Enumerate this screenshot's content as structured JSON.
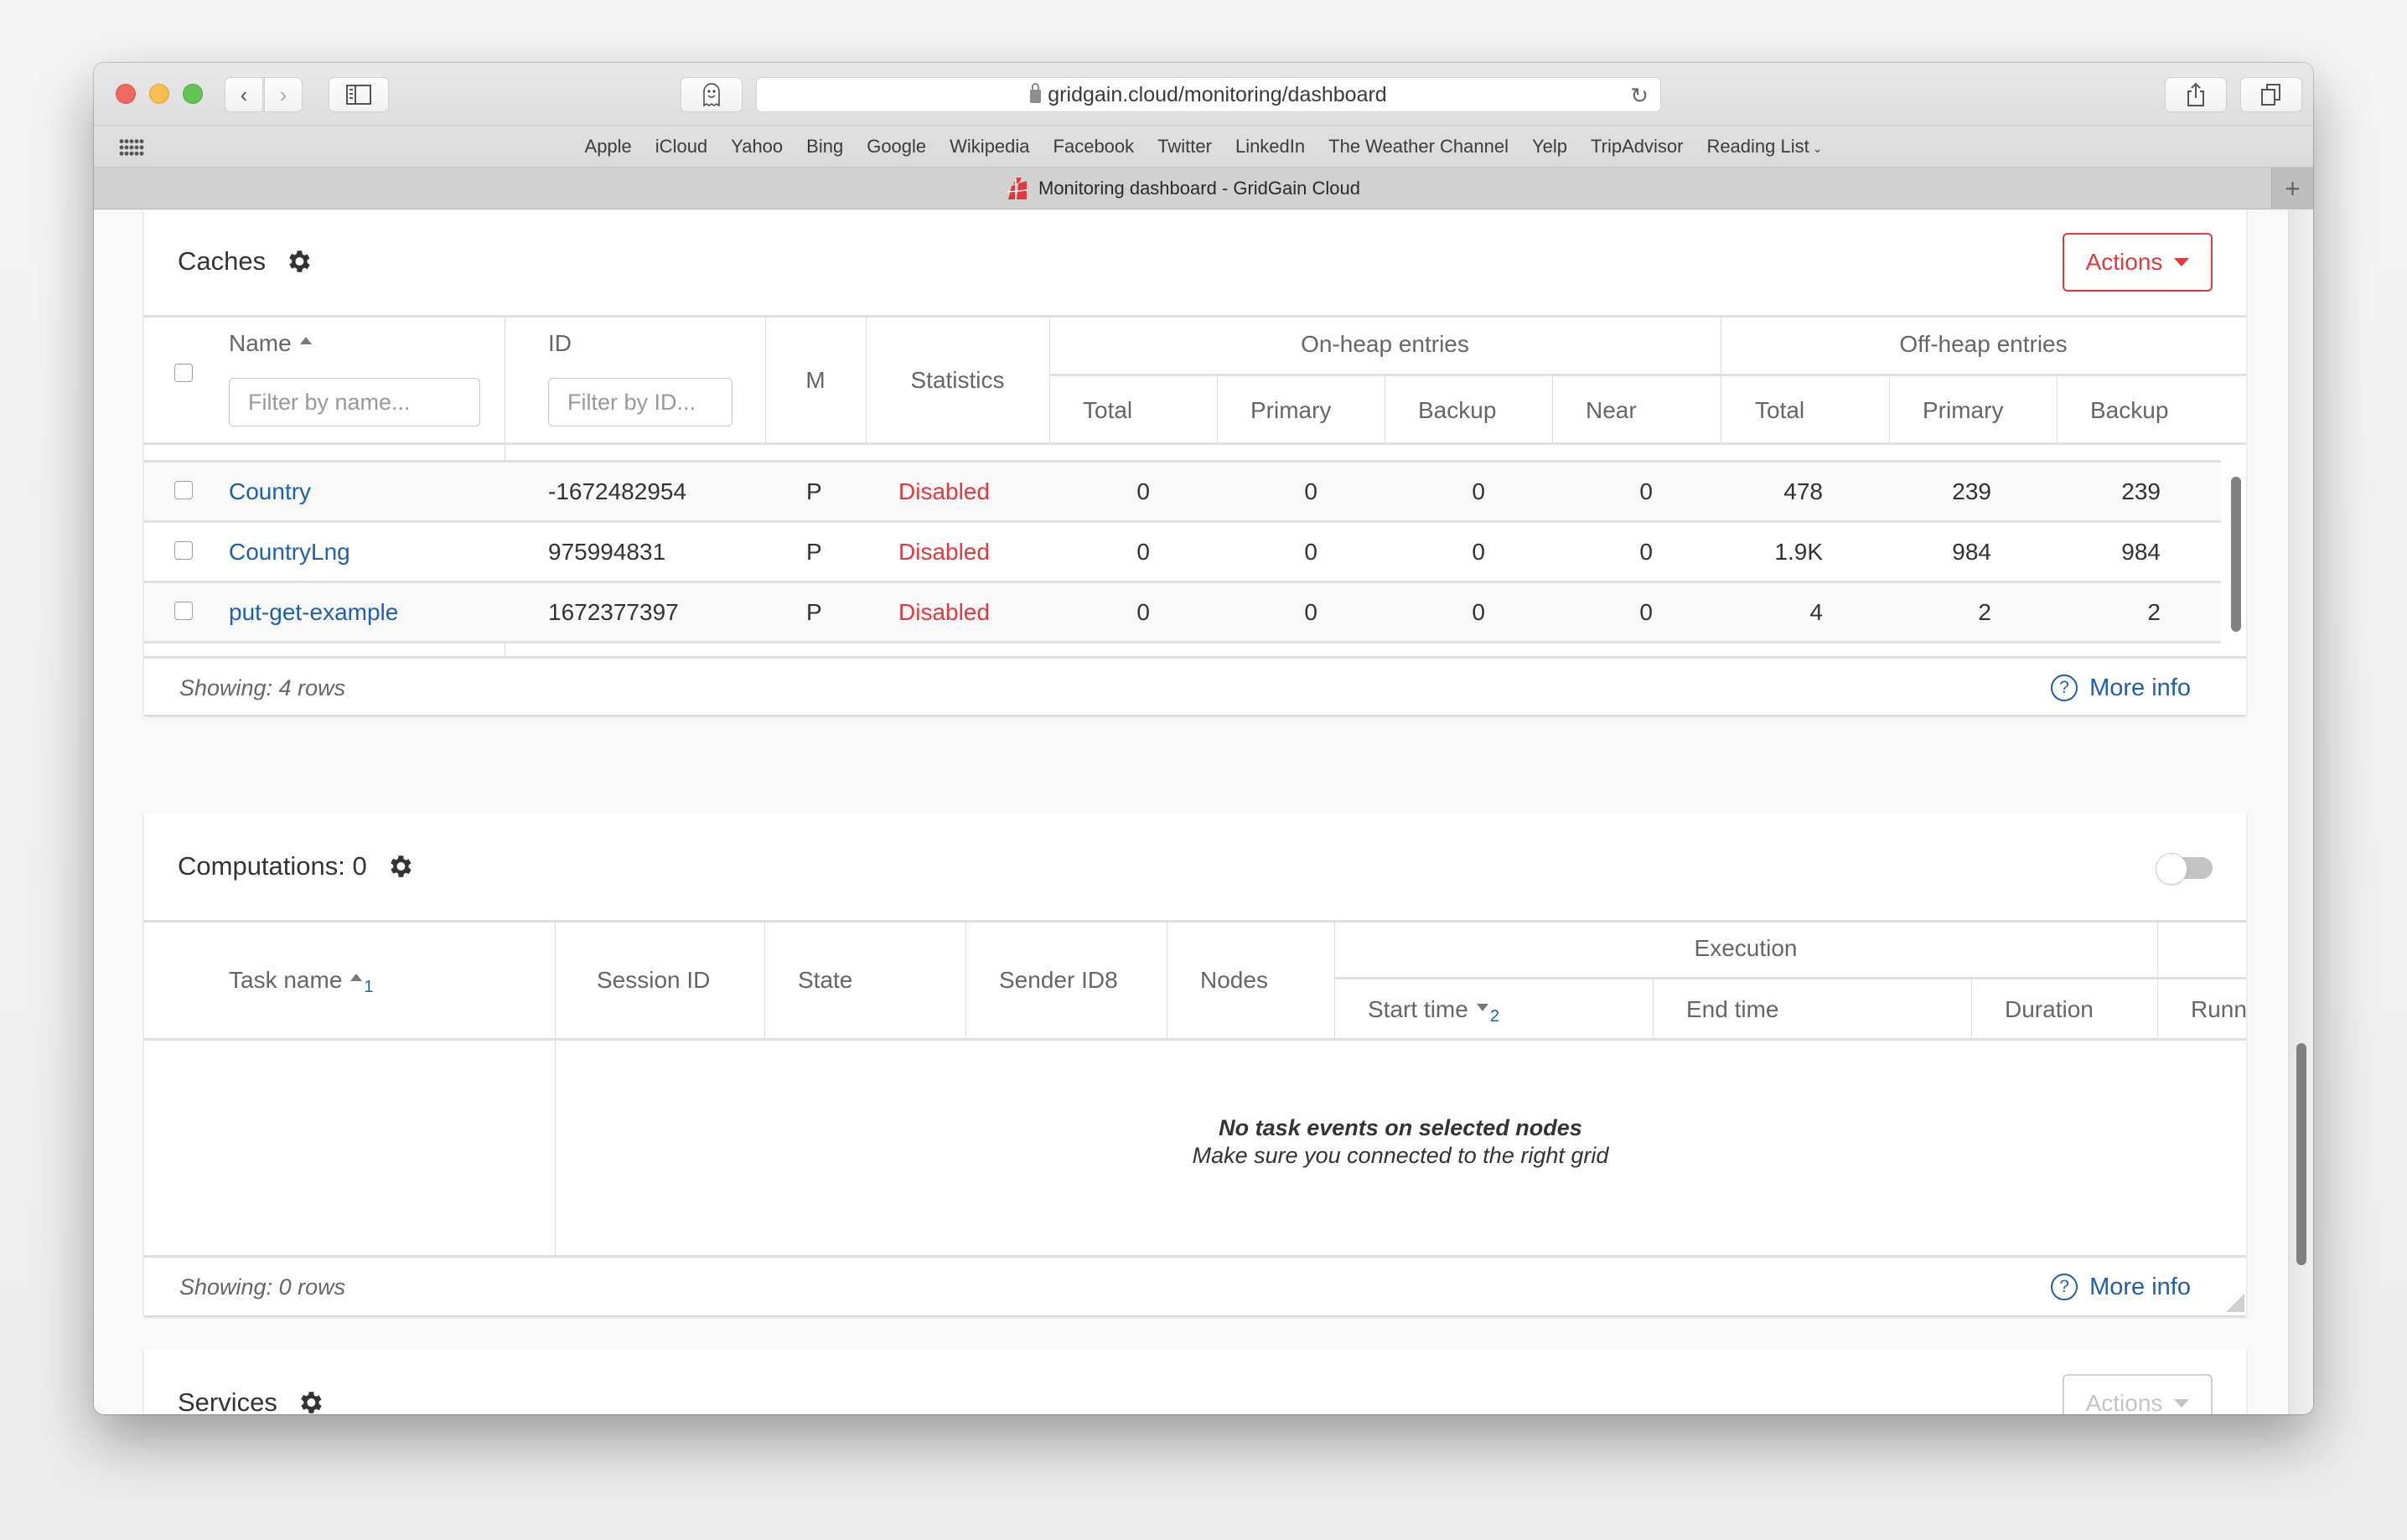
{
  "browser": {
    "url": "gridgain.cloud/monitoring/dashboard",
    "tab_title": "Monitoring dashboard - GridGain Cloud",
    "new_tab_label": "+",
    "bookmarks": [
      "Apple",
      "iCloud",
      "Yahoo",
      "Bing",
      "Google",
      "Wikipedia",
      "Facebook",
      "Twitter",
      "LinkedIn",
      "The Weather Channel",
      "Yelp",
      "TripAdvisor",
      "Reading List"
    ]
  },
  "colors": {
    "accent_red": "#e0393e",
    "link_blue": "#1f5fb0"
  },
  "caches": {
    "title": "Caches",
    "actions_label": "Actions",
    "columns": {
      "name": "Name",
      "id": "ID",
      "mode": "M",
      "statistics": "Statistics",
      "on_heap_group": "On-heap entries",
      "off_heap_group": "Off-heap entries",
      "on_heap": [
        "Total",
        "Primary",
        "Backup",
        "Near"
      ],
      "off_heap": [
        "Total",
        "Primary",
        "Backup"
      ]
    },
    "filters": {
      "name_placeholder": "Filter by name...",
      "id_placeholder": "Filter by ID..."
    },
    "rows": [
      {
        "name": "Country",
        "id": "-1672482954",
        "mode": "P",
        "statistics": "Disabled",
        "on_total": "0",
        "on_primary": "0",
        "on_backup": "0",
        "on_near": "0",
        "off_total": "478",
        "off_primary": "239",
        "off_backup": "239"
      },
      {
        "name": "CountryLng",
        "id": "975994831",
        "mode": "P",
        "statistics": "Disabled",
        "on_total": "0",
        "on_primary": "0",
        "on_backup": "0",
        "on_near": "0",
        "off_total": "1.9K",
        "off_primary": "984",
        "off_backup": "984"
      },
      {
        "name": "put-get-example",
        "id": "1672377397",
        "mode": "P",
        "statistics": "Disabled",
        "on_total": "0",
        "on_primary": "0",
        "on_backup": "0",
        "on_near": "0",
        "off_total": "4",
        "off_primary": "2",
        "off_backup": "2"
      }
    ],
    "showing": "Showing: 4 rows",
    "more_info": "More info"
  },
  "computations": {
    "title": "Computations: 0",
    "toggle_on": false,
    "columns": {
      "task_name": "Task name",
      "task_name_sort_index": "1",
      "session_id": "Session ID",
      "state": "State",
      "sender_id8": "Sender ID8",
      "nodes": "Nodes",
      "execution_group": "Execution",
      "start_time": "Start time",
      "start_time_sort_index": "2",
      "end_time": "End time",
      "duration": "Duration",
      "running": "Runn"
    },
    "empty_title": "No task events on selected nodes",
    "empty_subtitle": "Make sure you connected to the right grid",
    "showing": "Showing: 0 rows",
    "more_info": "More info"
  },
  "services": {
    "title": "Services",
    "actions_label": "Actions"
  }
}
